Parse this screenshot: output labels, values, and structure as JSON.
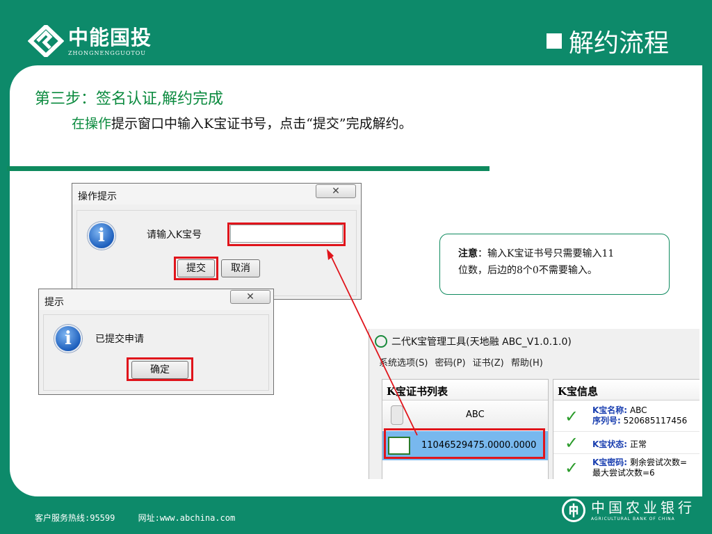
{
  "header": {
    "logo_cn": "中能国投",
    "logo_en": "ZHONGNENGGUOTOU",
    "section_title": "解约流程"
  },
  "step": {
    "title": "第三步：签名认证,解约完成",
    "desc_highlight": "在操作",
    "desc_rest": "提示窗口中输入K宝证书号，点击“提交”完成解约。"
  },
  "dialog_operate": {
    "title": "操作提示",
    "close_glyph": "✕",
    "prompt": "请输入K宝号",
    "input_value": "",
    "submit": "提交",
    "cancel": "取消"
  },
  "dialog_notice": {
    "title": "提示",
    "message": "已提交申请",
    "ok": "确定"
  },
  "note": {
    "label": "注意",
    "text_line1": "：输入K宝证书号只需要输入11",
    "text_line2": "位数，后边的8个0不需要输入。"
  },
  "tool_window": {
    "title": "二代K宝管理工具(天地融 ABC_V1.0.1.0)",
    "menu": [
      "系统选项(S)",
      "密码(P)",
      "证书(Z)",
      "帮助(H)"
    ],
    "list_header": "K宝证书列表",
    "info_header": "K宝信息",
    "list_items": [
      "ABC",
      "11046529475.0000.0000"
    ],
    "info_rows": [
      {
        "label": "K宝名称:",
        "value": "ABC",
        "label2": "序列号:",
        "value2": "520685117456"
      },
      {
        "label": "K宝状态:",
        "value": "正常"
      },
      {
        "label": "K宝密码:",
        "value": "剩余尝试次数=",
        "line2": "最大尝试次数=6"
      }
    ]
  },
  "footer": {
    "hotline": "客户服务热线:95599",
    "website": "网址:www.abchina.com",
    "bank_cn": "中国农业银行",
    "bank_en": "AGRICULTURAL BANK OF CHINA"
  },
  "colors": {
    "brand_green": "#0d8a6a",
    "highlight_red": "#e0141b",
    "text_green": "#0a8a3e",
    "selected_row": "#78b8ee"
  }
}
